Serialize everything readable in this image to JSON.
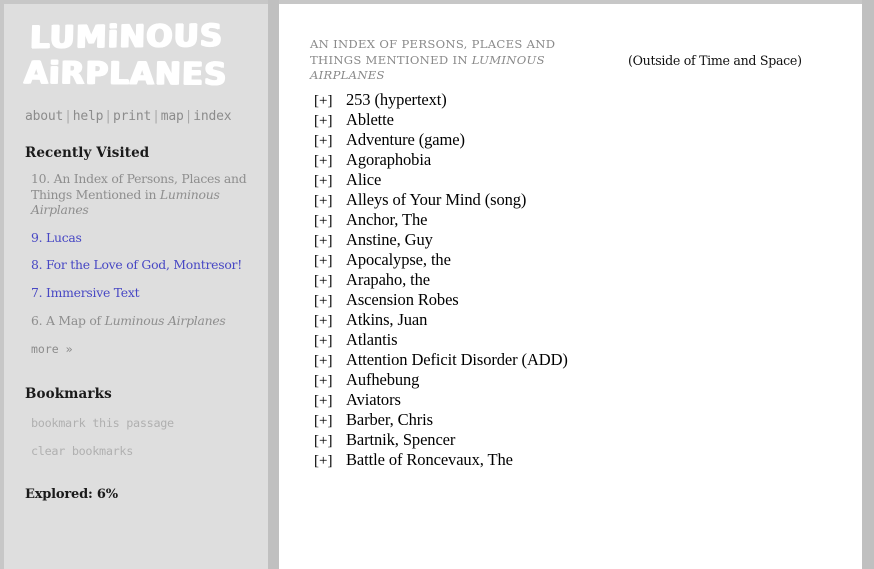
{
  "colors": {
    "sidebar_bg": "#dedede",
    "divider": "#c0c0c0",
    "content_bg": "#ffffff",
    "link": "#4747c4",
    "muted": "#8e8e8e",
    "title_gray": "#8a8a8a",
    "logo": "#ffffff"
  },
  "sidebar": {
    "logo": {
      "line1": "LUMiNOUS",
      "line2": "AiRPLANES"
    },
    "nav": {
      "separator": "|",
      "items": [
        {
          "label": "about"
        },
        {
          "label": "help"
        },
        {
          "label": "print"
        },
        {
          "label": "map"
        },
        {
          "label": "index"
        }
      ]
    },
    "recently_visited": {
      "heading": "Recently Visited",
      "items": [
        {
          "number": "10.",
          "text_before": " An Index of Persons, Places and Things Mentioned in ",
          "italic": "Luminous Airplanes",
          "text_after": "",
          "state": "current"
        },
        {
          "number": "9.",
          "text_before": " Lucas",
          "italic": "",
          "text_after": "",
          "state": "link"
        },
        {
          "number": "8.",
          "text_before": " For the Love of God, Montresor!",
          "italic": "",
          "text_after": "",
          "state": "link"
        },
        {
          "number": "7.",
          "text_before": " Immersive Text",
          "italic": "",
          "text_after": "",
          "state": "link"
        },
        {
          "number": "6.",
          "text_before": " A Map of ",
          "italic": "Luminous Airplanes",
          "text_after": "",
          "state": "visited"
        }
      ],
      "more_label": "more »"
    },
    "bookmarks": {
      "heading": "Bookmarks",
      "add_label": "bookmark this passage",
      "clear_label": "clear bookmarks"
    },
    "explored": {
      "label": "Explored:",
      "value": "6%",
      "full": "Explored: 6%"
    }
  },
  "content": {
    "title_part1": "An index of persons, places and things mentioned in ",
    "title_italic": "Luminous Airplanes",
    "outside_note": "(Outside of Time and Space)",
    "toggle_symbol": "[+]",
    "entries": [
      {
        "label": "253 (hypertext)"
      },
      {
        "label": "Ablette"
      },
      {
        "label": "Adventure (game)"
      },
      {
        "label": "Agoraphobia"
      },
      {
        "label": "Alice"
      },
      {
        "label": "Alleys of Your Mind (song)"
      },
      {
        "label": "Anchor, The"
      },
      {
        "label": "Anstine, Guy"
      },
      {
        "label": "Apocalypse, the"
      },
      {
        "label": "Arapaho, the"
      },
      {
        "label": "Ascension Robes"
      },
      {
        "label": "Atkins, Juan"
      },
      {
        "label": "Atlantis"
      },
      {
        "label": "Attention Deficit Disorder (ADD)"
      },
      {
        "label": "Aufhebung"
      },
      {
        "label": "Aviators"
      },
      {
        "label": "Barber, Chris"
      },
      {
        "label": "Bartnik, Spencer"
      },
      {
        "label": "Battle of Roncevaux, The"
      }
    ]
  }
}
